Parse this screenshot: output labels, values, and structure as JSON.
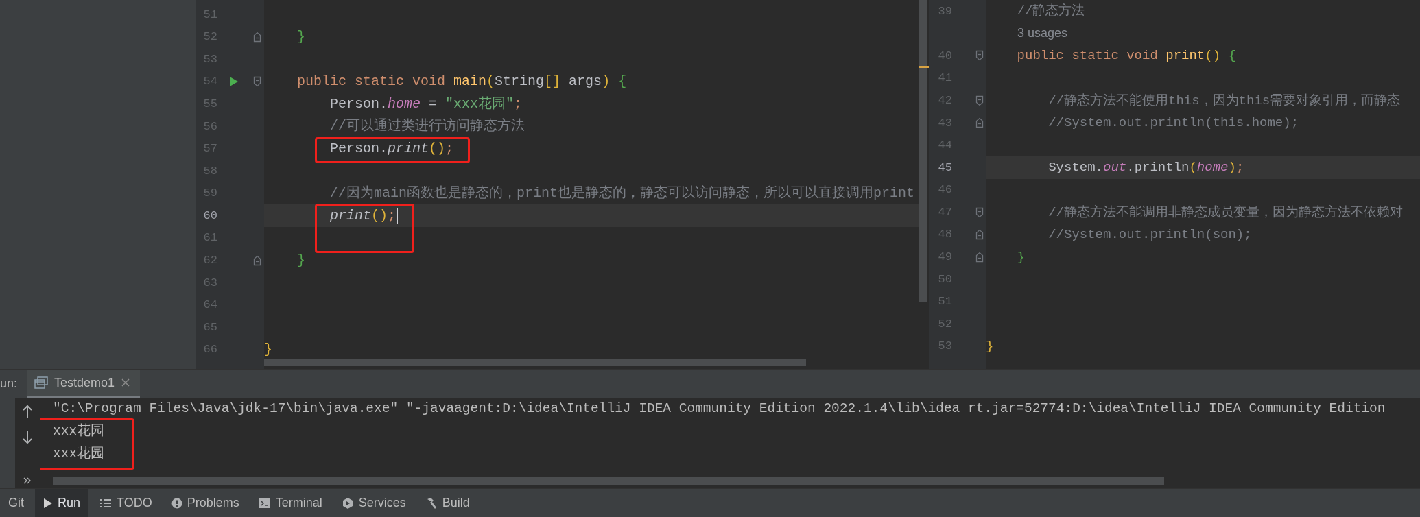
{
  "left_editor": {
    "lines": [
      {
        "number": "51",
        "highlighted": false,
        "cursor": false
      },
      {
        "number": "52",
        "gutter": [
          {
            "kind": "fold_end"
          }
        ],
        "highlighted": false,
        "cursor": false,
        "tokens": [
          {
            "text": "    }",
            "kind": "green"
          }
        ]
      },
      {
        "number": "53",
        "highlighted": false,
        "cursor": false
      },
      {
        "number": "54",
        "gutter": [
          {
            "kind": "run"
          },
          {
            "kind": "fold_start"
          }
        ],
        "highlighted": false,
        "cursor": false,
        "tokens": [
          {
            "text": "    public static void ",
            "kind": "keyword"
          },
          {
            "text": "main",
            "kind": "decl"
          },
          {
            "text": "(",
            "kind": "yellow"
          },
          {
            "text": "String",
            "kind": "plain"
          },
          {
            "text": "[]",
            "kind": "yellow"
          },
          {
            "text": " args",
            "kind": "plain"
          },
          {
            "text": ")",
            "kind": "yellow"
          },
          {
            "text": " {",
            "kind": "green"
          }
        ]
      },
      {
        "number": "55",
        "highlighted": false,
        "cursor": false,
        "tokens": [
          {
            "text": "        Person.",
            "kind": "plain"
          },
          {
            "text": "home",
            "kind": "field"
          },
          {
            "text": " = ",
            "kind": "plain"
          },
          {
            "text": "\"xxx花园\"",
            "kind": "string"
          },
          {
            "text": ";",
            "kind": "keyword"
          }
        ]
      },
      {
        "number": "56",
        "highlighted": false,
        "cursor": false,
        "tokens": [
          {
            "text": "        //可以通过类进行访问静态方法",
            "kind": "comment"
          }
        ]
      },
      {
        "number": "57",
        "highlighted": true,
        "cursor": false,
        "tokens": [
          {
            "text": "        Person.",
            "kind": "plain"
          },
          {
            "text": "print",
            "kind": "italic"
          },
          {
            "text": "()",
            "kind": "yellow"
          },
          {
            "text": ";",
            "kind": "keyword"
          }
        ]
      },
      {
        "number": "58",
        "highlighted": false,
        "cursor": false
      },
      {
        "number": "59",
        "highlighted": false,
        "cursor": false,
        "tokens": [
          {
            "text": "        //因为main函数也是静态的，print也是静态的，静态可以访问静态，所以可以直接调用print",
            "kind": "comment"
          }
        ]
      },
      {
        "number": "60",
        "current": true,
        "highlighted": true,
        "cursor": true,
        "tokens": [
          {
            "text": "        print",
            "kind": "italic"
          },
          {
            "text": "()",
            "kind": "yellow"
          },
          {
            "text": ";",
            "kind": "keyword"
          }
        ]
      },
      {
        "number": "61",
        "highlighted": true,
        "cursor": false
      },
      {
        "number": "62",
        "gutter": [
          {
            "kind": "fold_end"
          }
        ],
        "highlighted": false,
        "cursor": false,
        "tokens": [
          {
            "text": "    }",
            "kind": "green"
          }
        ]
      },
      {
        "number": "63",
        "highlighted": false,
        "cursor": false
      },
      {
        "number": "64",
        "highlighted": false,
        "cursor": false
      },
      {
        "number": "65",
        "highlighted": false,
        "cursor": false
      },
      {
        "number": "66",
        "highlighted": false,
        "cursor": false,
        "tokens": [
          {
            "text": "}",
            "kind": "yellow"
          }
        ]
      }
    ]
  },
  "right_editor": {
    "lines": [
      {
        "kind": "code",
        "number": "39",
        "tokens": [
          {
            "text": "    //静态方法",
            "kind": "comment"
          }
        ]
      },
      {
        "kind": "inlay",
        "text": "3 usages"
      },
      {
        "kind": "code",
        "number": "40",
        "gutter": [
          {
            "kind": "fold_start"
          }
        ],
        "tokens": [
          {
            "text": "    public static void ",
            "kind": "keyword"
          },
          {
            "text": "print",
            "kind": "decl"
          },
          {
            "text": "()",
            "kind": "yellow"
          },
          {
            "text": " {",
            "kind": "green"
          }
        ]
      },
      {
        "kind": "code",
        "number": "41"
      },
      {
        "kind": "code",
        "number": "42",
        "gutter": [
          {
            "kind": "fold_start"
          }
        ],
        "tokens": [
          {
            "text": "        //静态方法不能使用this，因为this需要对象引用，而静态",
            "kind": "comment"
          }
        ]
      },
      {
        "kind": "code",
        "number": "43",
        "gutter": [
          {
            "kind": "fold_end"
          }
        ],
        "tokens": [
          {
            "text": "        //System.out.println(this.home);",
            "kind": "comment"
          }
        ]
      },
      {
        "kind": "code",
        "number": "44"
      },
      {
        "kind": "code",
        "number": "45",
        "current": true,
        "tokens": [
          {
            "text": "        System.",
            "kind": "plain"
          },
          {
            "text": "out",
            "kind": "field"
          },
          {
            "text": ".println",
            "kind": "plain"
          },
          {
            "text": "(",
            "kind": "yellow"
          },
          {
            "text": "home",
            "kind": "field"
          },
          {
            "text": ")",
            "kind": "yellow"
          },
          {
            "text": ";",
            "kind": "keyword"
          }
        ]
      },
      {
        "kind": "code",
        "number": "46"
      },
      {
        "kind": "code",
        "number": "47",
        "gutter": [
          {
            "kind": "fold_start"
          }
        ],
        "tokens": [
          {
            "text": "        //静态方法不能调用非静态成员变量，因为静态方法不依赖对",
            "kind": "comment"
          }
        ]
      },
      {
        "kind": "code",
        "number": "48",
        "gutter": [
          {
            "kind": "fold_end"
          }
        ],
        "tokens": [
          {
            "text": "        //System.out.println(son);",
            "kind": "comment"
          }
        ]
      },
      {
        "kind": "code",
        "number": "49",
        "gutter": [
          {
            "kind": "fold_end"
          }
        ],
        "tokens": [
          {
            "text": "    }",
            "kind": "green"
          }
        ]
      },
      {
        "kind": "code",
        "number": "50"
      },
      {
        "kind": "code",
        "number": "51"
      },
      {
        "kind": "code",
        "number": "52"
      },
      {
        "kind": "code",
        "number": "53",
        "tokens": [
          {
            "text": "}",
            "kind": "yellow"
          }
        ]
      }
    ]
  },
  "run_panel": {
    "label": "un:",
    "tabs": [
      {
        "label": "Testdemo1",
        "selected": true
      }
    ],
    "console": [
      {
        "text": "\"C:\\Program Files\\Java\\jdk-17\\bin\\java.exe\" \"-javaagent:D:\\idea\\IntelliJ IDEA Community Edition 2022.1.4\\lib\\idea_rt.jar=52774:D:\\idea\\IntelliJ IDEA Community Edition",
        "highlighted": false
      },
      {
        "text": "xxx花园",
        "highlighted": true
      },
      {
        "text": "xxx花园",
        "highlighted": true
      }
    ]
  },
  "tool_window_bar": [
    {
      "label": "Git",
      "selected": false
    },
    {
      "label": "Run",
      "selected": true
    },
    {
      "label": "TODO",
      "selected": false
    },
    {
      "label": "Problems",
      "selected": false
    },
    {
      "label": "Terminal",
      "selected": false
    },
    {
      "label": "Services",
      "selected": false
    },
    {
      "label": "Build",
      "selected": false
    }
  ]
}
